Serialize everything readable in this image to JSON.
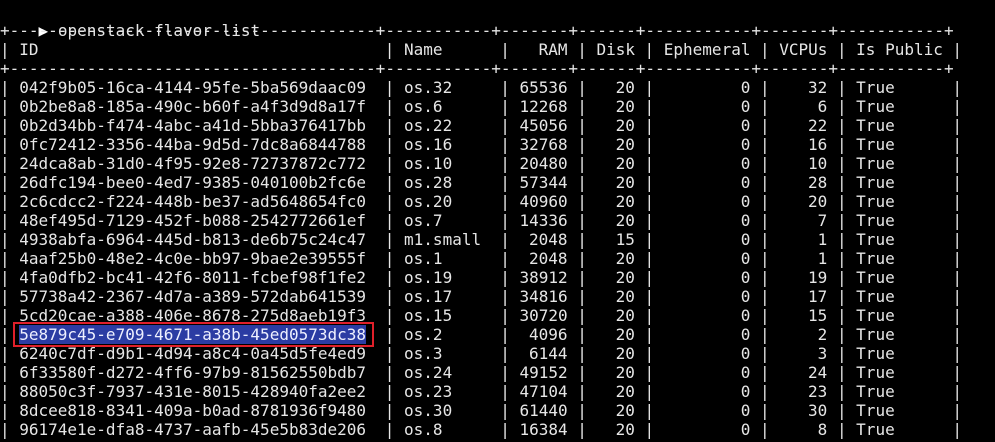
{
  "terminal": {
    "prompt_glyph": "▶",
    "command": "openstack flavor list"
  },
  "table": {
    "border_line": "+--------------------------------------+-----------+-------+------+-----------+-------+-----------+",
    "headers": [
      "ID",
      "Name",
      "RAM",
      "Disk",
      "Ephemeral",
      "VCPUs",
      "Is Public"
    ],
    "rows": [
      {
        "id": "042f9b05-16ca-4144-95fe-5ba569daac09",
        "name": "os.32",
        "ram": "65536",
        "disk": "20",
        "ephemeral": "0",
        "vcpus": "32",
        "public": "True"
      },
      {
        "id": "0b2be8a8-185a-490c-b60f-a4f3d9d8a17f",
        "name": "os.6",
        "ram": "12268",
        "disk": "20",
        "ephemeral": "0",
        "vcpus": "6",
        "public": "True"
      },
      {
        "id": "0b2d34bb-f474-4abc-a41d-5bba376417bb",
        "name": "os.22",
        "ram": "45056",
        "disk": "20",
        "ephemeral": "0",
        "vcpus": "22",
        "public": "True"
      },
      {
        "id": "0fc72412-3356-44ba-9d5d-7dc8a6844788",
        "name": "os.16",
        "ram": "32768",
        "disk": "20",
        "ephemeral": "0",
        "vcpus": "16",
        "public": "True"
      },
      {
        "id": "24dca8ab-31d0-4f95-92e8-72737872c772",
        "name": "os.10",
        "ram": "20480",
        "disk": "20",
        "ephemeral": "0",
        "vcpus": "10",
        "public": "True"
      },
      {
        "id": "26dfc194-bee0-4ed7-9385-040100b2fc6e",
        "name": "os.28",
        "ram": "57344",
        "disk": "20",
        "ephemeral": "0",
        "vcpus": "28",
        "public": "True"
      },
      {
        "id": "2c6cdcc2-f224-448b-be37-ad5648654fc0",
        "name": "os.20",
        "ram": "40960",
        "disk": "20",
        "ephemeral": "0",
        "vcpus": "20",
        "public": "True"
      },
      {
        "id": "48ef495d-7129-452f-b088-2542772661ef",
        "name": "os.7",
        "ram": "14336",
        "disk": "20",
        "ephemeral": "0",
        "vcpus": "7",
        "public": "True"
      },
      {
        "id": "4938abfa-6964-445d-b813-de6b75c24c47",
        "name": "m1.small",
        "ram": "2048",
        "disk": "15",
        "ephemeral": "0",
        "vcpus": "1",
        "public": "True"
      },
      {
        "id": "4aaf25b0-48e2-4c0e-bb97-9bae2e39555f",
        "name": "os.1",
        "ram": "2048",
        "disk": "20",
        "ephemeral": "0",
        "vcpus": "1",
        "public": "True"
      },
      {
        "id": "4fa0dfb2-bc41-42f6-8011-fcbef98f1fe2",
        "name": "os.19",
        "ram": "38912",
        "disk": "20",
        "ephemeral": "0",
        "vcpus": "19",
        "public": "True"
      },
      {
        "id": "57738a42-2367-4d7a-a389-572dab641539",
        "name": "os.17",
        "ram": "34816",
        "disk": "20",
        "ephemeral": "0",
        "vcpus": "17",
        "public": "True"
      },
      {
        "id": "5cd20cae-a388-406e-8678-275d8aeb19f3",
        "name": "os.15",
        "ram": "30720",
        "disk": "20",
        "ephemeral": "0",
        "vcpus": "15",
        "public": "True"
      },
      {
        "id": "5e879c45-e709-4671-a38b-45ed0573dc38",
        "name": "os.2",
        "ram": "4096",
        "disk": "20",
        "ephemeral": "0",
        "vcpus": "2",
        "public": "True",
        "selected": true
      },
      {
        "id": "6240c7df-d9b1-4d94-a8c4-0a45d5fe4ed9",
        "name": "os.3",
        "ram": "6144",
        "disk": "20",
        "ephemeral": "0",
        "vcpus": "3",
        "public": "True"
      },
      {
        "id": "6f33580f-d272-4ff6-97b9-81562550bdb7",
        "name": "os.24",
        "ram": "49152",
        "disk": "20",
        "ephemeral": "0",
        "vcpus": "24",
        "public": "True"
      },
      {
        "id": "88050c3f-7937-431e-8015-428940fa2ee2",
        "name": "os.23",
        "ram": "47104",
        "disk": "20",
        "ephemeral": "0",
        "vcpus": "23",
        "public": "True"
      },
      {
        "id": "8dcee818-8341-409a-b0ad-8781936f9480",
        "name": "os.30",
        "ram": "61440",
        "disk": "20",
        "ephemeral": "0",
        "vcpus": "30",
        "public": "True"
      },
      {
        "id": "96174e1e-dfa8-4737-aafb-45e5b83de206",
        "name": "os.8",
        "ram": "16384",
        "disk": "20",
        "ephemeral": "0",
        "vcpus": "8",
        "public": "True"
      }
    ]
  },
  "colors": {
    "background": "#000000",
    "foreground": "#e6e6e6",
    "selection_bg": "#2b3ca3",
    "highlight_border": "#e0202a"
  }
}
